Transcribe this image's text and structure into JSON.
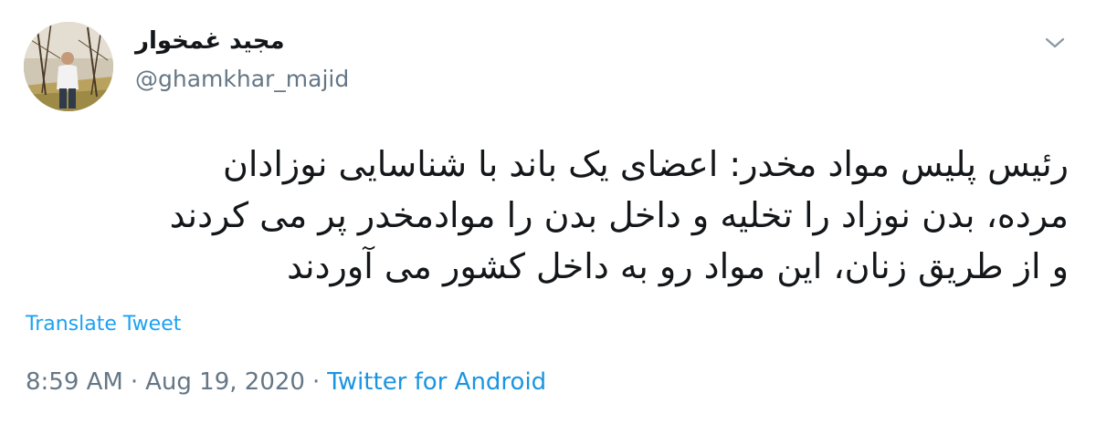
{
  "user": {
    "display_name": "مجید غمخوار",
    "handle": "@ghamkhar_majid",
    "avatar": "profile-photo-man-standing-outdoors"
  },
  "tweet": {
    "lines": [
      "رئیس پلیس مواد مخدر: اعضای یک باند با شناسایی نوزادان",
      "مرده، بدن نوزاد را تخلیه و داخل بدن را موادمخدر پر می کردند",
      "و از طریق زنان، این مواد رو به داخل کشور می آوردند"
    ],
    "translate_label": "Translate Tweet",
    "time": "8:59 AM",
    "separator": "·",
    "date": "Aug 19, 2020",
    "source": "Twitter for Android"
  },
  "icons": {
    "caret": "chevron-down-icon"
  },
  "colors": {
    "text": "#14171a",
    "secondary": "#657786",
    "link": "#1da1f2",
    "background": "#ffffff"
  }
}
